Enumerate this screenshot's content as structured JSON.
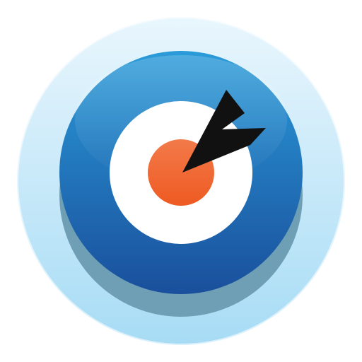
{
  "icon": {
    "name": "target-bullseye-app-icon",
    "colors": {
      "outer_disc_top": "#e9f6fd",
      "outer_disc_bottom": "#a7dcf5",
      "base_shadow": "#6f9fb5",
      "ring_top": "#2a9bd9",
      "ring_bottom": "#1a4f9c",
      "inner_white": "#ffffff",
      "bullseye_top": "#f37a4a",
      "bullseye_bottom": "#ee5a22",
      "arrow": "#111111"
    }
  }
}
